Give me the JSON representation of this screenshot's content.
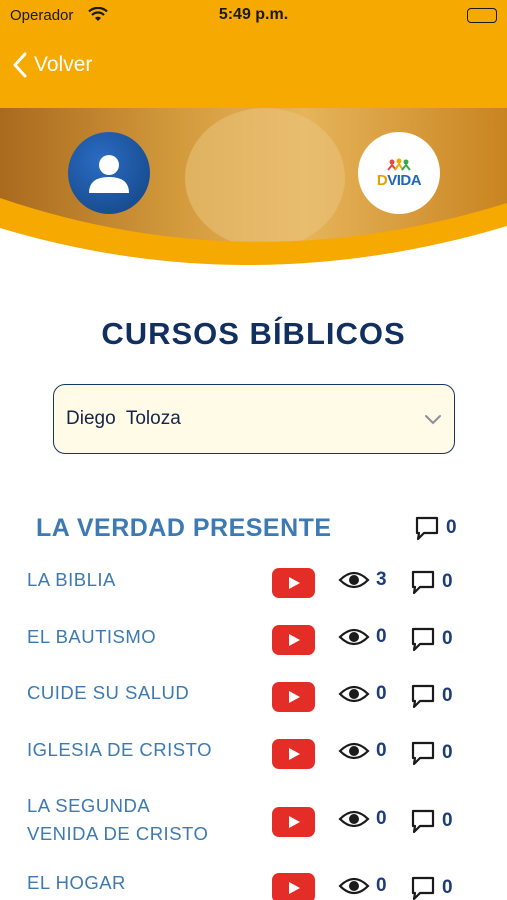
{
  "status_bar": {
    "carrier": "Operador",
    "time": "5:49 p.m."
  },
  "nav": {
    "back_label": "Volver"
  },
  "logo": {
    "text_part1": "D",
    "text_part2": "VIDA"
  },
  "page": {
    "title": "CURSOS BÍBLICOS"
  },
  "student_select": {
    "selected": "Diego  Toloza"
  },
  "section": {
    "title": "LA VERDAD PRESENTE",
    "comments": "0"
  },
  "lessons": [
    {
      "title_line1": "LA BIBLIA",
      "title_line2": "",
      "views": "3",
      "comments": "0"
    },
    {
      "title_line1": "EL BAUTISMO",
      "title_line2": "",
      "views": "0",
      "comments": "0"
    },
    {
      "title_line1": "CUIDE SU SALUD",
      "title_line2": "",
      "views": "0",
      "comments": "0"
    },
    {
      "title_line1": "IGLESIA DE CRISTO",
      "title_line2": "",
      "views": "0",
      "comments": "0"
    },
    {
      "title_line1": "LA SEGUNDA",
      "title_line2": "VENIDA DE CRISTO",
      "views": "0",
      "comments": "0"
    },
    {
      "title_line1": "EL HOGAR",
      "title_line2": "",
      "views": "0",
      "comments": "0"
    }
  ],
  "colors": {
    "header": "#f6a900",
    "title": "#12305f",
    "link": "#3d7ab3",
    "youtube": "#e52d27"
  }
}
